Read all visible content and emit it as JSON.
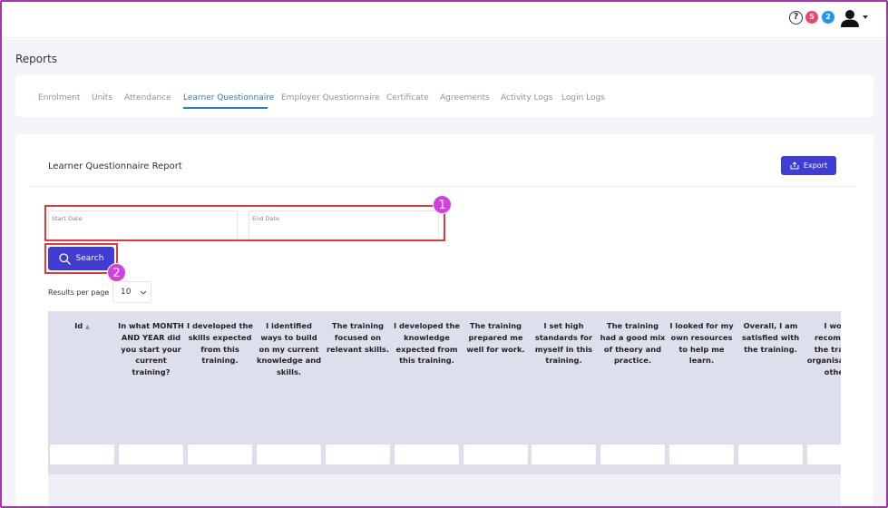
{
  "header": {
    "help_icon": "?",
    "notification_count_red": "5",
    "notification_count_blue": "2",
    "colors": {
      "red_badge": "#f0466a",
      "blue_badge": "#2196f3"
    }
  },
  "page": {
    "title": "Reports"
  },
  "tabs": [
    {
      "label": "Enrolment",
      "active": false
    },
    {
      "label": "Units",
      "active": false
    },
    {
      "label": "Attendance",
      "active": false
    },
    {
      "label": "Learner Questionnaire",
      "active": true
    },
    {
      "label": "Employer Questionnaire",
      "active": false
    },
    {
      "label": "Certificate",
      "active": false
    },
    {
      "label": "Agreements",
      "active": false
    },
    {
      "label": "Activity Logs",
      "active": false
    },
    {
      "label": "Login Logs",
      "active": false
    }
  ],
  "report": {
    "title": "Learner Questionnaire Report",
    "export_label": "Export",
    "start_date_label": "Start Date",
    "end_date_label": "End Date",
    "start_date_value": "",
    "end_date_value": "",
    "search_label": "Search",
    "results_per_page_label": "Results per page",
    "results_per_page_value": "10"
  },
  "annotations": {
    "callout_1": "1",
    "callout_2": "2"
  },
  "table": {
    "columns": [
      "Id",
      "In what MONTH AND YEAR did you start your current training?",
      "I developed the skills expected from this training.",
      "I identified ways to build on my current knowledge and skills.",
      "The training focused on relevant skills.",
      "I developed the knowledge expected from this training.",
      "The training prepared me well for work.",
      "I set high standards for myself in this training.",
      "The training had a good mix of theory and practice.",
      "I looked for my own resources to help me learn.",
      "Overall, I am satisfied with the training.",
      "I would recommend the training organisation to others."
    ]
  },
  "colors": {
    "primary": "#3f3dd3",
    "active_tab": "#2a7ad8",
    "highlight": "#e03a3a",
    "callout": "#d33fe0"
  }
}
